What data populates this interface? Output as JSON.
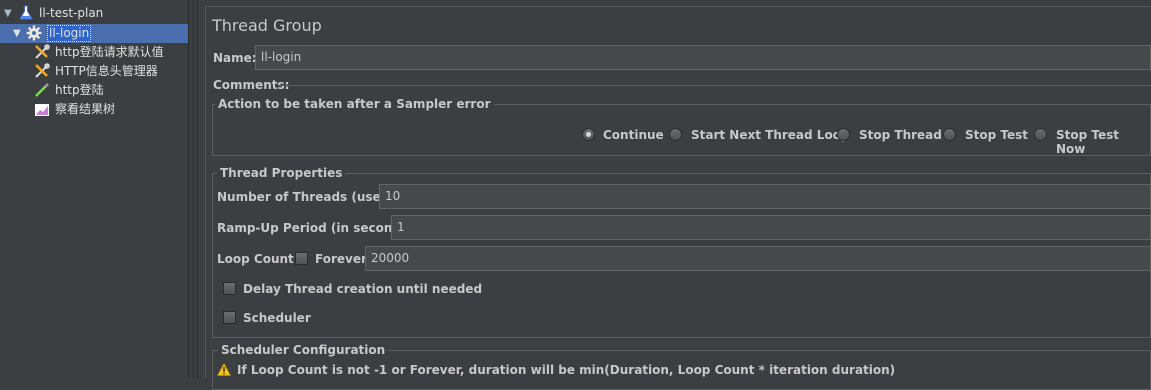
{
  "tree": {
    "plan": {
      "label": "ll-test-plan",
      "icon": "flask-icon"
    },
    "group": {
      "label": "ll-login",
      "icon": "gear-icon"
    },
    "items": [
      {
        "label": "http登陆请求默认值",
        "icon": "wrench-icon"
      },
      {
        "label": "HTTP信息头管理器",
        "icon": "wrench-icon"
      },
      {
        "label": "http登陆",
        "icon": "pipette-icon"
      },
      {
        "label": "察看结果树",
        "icon": "chart-icon"
      }
    ]
  },
  "panel": {
    "title": "Thread Group",
    "name_label": "Name:",
    "name_value": "ll-login",
    "comments_label": "Comments:",
    "sampler_error": {
      "legend": "Action to be taken after a Sampler error",
      "options": [
        "Continue",
        "Start Next Thread Loop",
        "Stop Thread",
        "Stop Test",
        "Stop Test Now"
      ],
      "selected": "Continue"
    },
    "thread_props": {
      "legend": "Thread Properties",
      "threads_label": "Number of Threads (users):",
      "threads_value": "10",
      "rampup_label": "Ramp-Up Period (in seconds):",
      "rampup_value": "1",
      "loop_label": "Loop Count:",
      "forever_label": "Forever",
      "loop_value": "20000",
      "delay_label": "Delay Thread creation until needed",
      "scheduler_label": "Scheduler"
    },
    "scheduler_config": {
      "legend": "Scheduler Configuration",
      "warning": "If Loop Count is not -1 or Forever, duration will be min(Duration, Loop Count * iteration duration)"
    }
  },
  "colors": {
    "background": "#3c3f41",
    "selection": "#4b6eaf",
    "text": "#c8c8c8"
  }
}
